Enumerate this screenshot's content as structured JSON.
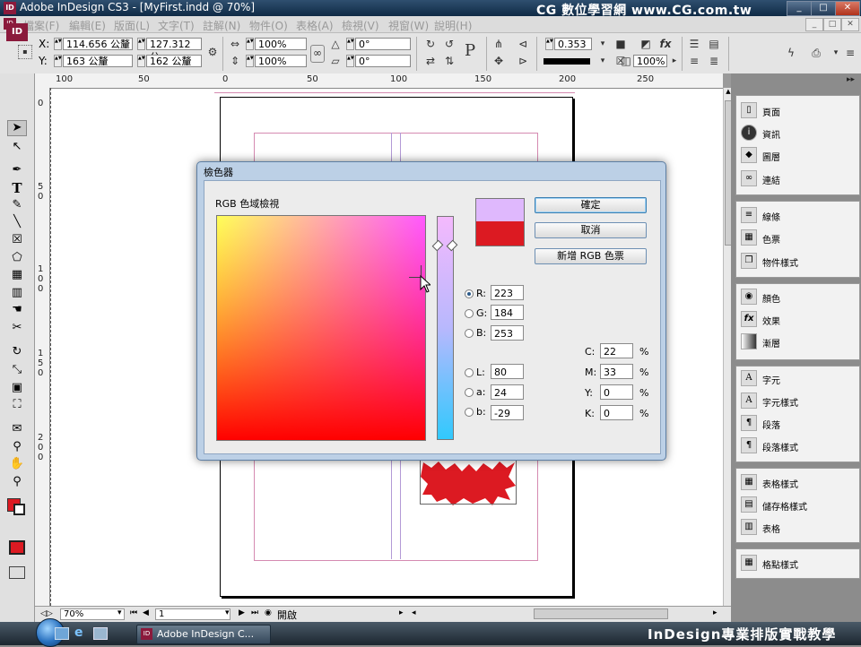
{
  "window": {
    "app_icon": "ID",
    "title": "Adobe InDesign CS3 - [MyFirst.indd @ 70%]",
    "watermark": "CG 數位學習網 www.CG.com.tw",
    "controls": [
      "_",
      "□",
      "✕"
    ]
  },
  "menubar": {
    "doc_icon": "ID",
    "items": [
      "檔案(F)",
      "編輯(E)",
      "版面(L)",
      "文字(T)",
      "註解(N)",
      "物件(O)",
      "表格(A)",
      "檢視(V)",
      "視窗(W)",
      "說明(H)"
    ],
    "mdi_controls": [
      "_",
      "□",
      "✕"
    ]
  },
  "controlbar": {
    "x_label": "X:",
    "x_value": "114.656 公釐",
    "y_label": "Y:",
    "y_value": "163 公釐",
    "w_label": "寬:",
    "w_value": "127.312 公",
    "h_label": "高:",
    "h_value": "162 公釐",
    "scale_x": "100%",
    "scale_y": "100%",
    "rotate": "0°",
    "shear": "0°",
    "stroke_weight": "0.353",
    "opacity": "100%"
  },
  "toolbox": {
    "logo": "ID",
    "tools": [
      "selection-arrow-icon",
      "direct-select-arrow-icon",
      "pen-icon",
      "type-icon",
      "pencil-icon",
      "line-icon",
      "rectangle-frame-icon",
      "ellipse-icon",
      "table-icon",
      "grid-icon",
      "paint-bucket-icon",
      "scissors-icon",
      "rotate-icon",
      "scale-icon",
      "gradient-icon",
      "free-transform-icon",
      "note-icon",
      "eyedropper-icon",
      "hand-icon",
      "zoom-icon"
    ]
  },
  "rulers": {
    "h_ticks": [
      "100",
      "50",
      "0",
      "50",
      "100",
      "150",
      "200",
      "250"
    ],
    "v_ticks": [
      "0",
      "5 0",
      "1 0 0",
      "1 5 0",
      "2 0 0"
    ]
  },
  "statusbar": {
    "zoom": "70%",
    "page": "1",
    "status": "開啟"
  },
  "panels": {
    "group1": [
      "頁面",
      "資訊",
      "圖層",
      "連結"
    ],
    "group2": [
      "線條",
      "色票",
      "物件樣式"
    ],
    "group3": [
      "顏色",
      "效果",
      "漸層"
    ],
    "group4": [
      "字元",
      "字元樣式",
      "段落",
      "段落樣式"
    ],
    "group5": [
      "表格樣式",
      "儲存格樣式",
      "表格"
    ],
    "group6": [
      "格點樣式"
    ]
  },
  "color_picker": {
    "title": "檢色器",
    "field_label": "RGB 色域檢視",
    "new_color": "#dfb8fd",
    "old_color": "#dc1a22",
    "ok_label": "確定",
    "cancel_label": "取消",
    "add_swatch_label": "新增 RGB 色票",
    "rgb": [
      {
        "label": "R:",
        "value": "223",
        "selected": true
      },
      {
        "label": "G:",
        "value": "184",
        "selected": false
      },
      {
        "label": "B:",
        "value": "253",
        "selected": false
      }
    ],
    "lab": [
      {
        "label": "L:",
        "value": "80"
      },
      {
        "label": "a:",
        "value": "24"
      },
      {
        "label": "b:",
        "value": "-29"
      }
    ],
    "cmyk": [
      {
        "label": "C:",
        "value": "22",
        "unit": "%"
      },
      {
        "label": "M:",
        "value": "33",
        "unit": "%"
      },
      {
        "label": "Y:",
        "value": "0",
        "unit": "%"
      },
      {
        "label": "K:",
        "value": "0",
        "unit": "%"
      }
    ]
  },
  "taskbar": {
    "app_button": "Adobe InDesign C...",
    "caption": "InDesign專業排版實戰教學"
  },
  "colors": {
    "indesign_brand": "#8b1a3c",
    "starburst": "#dc1a22",
    "margin_guide": "#d58ab1"
  }
}
